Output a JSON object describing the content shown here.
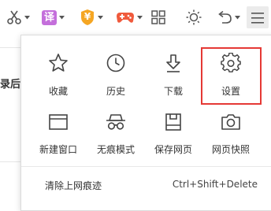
{
  "menu": {
    "row1": [
      {
        "label": "收藏"
      },
      {
        "label": "历史"
      },
      {
        "label": "下载"
      },
      {
        "label": "设置"
      }
    ],
    "row2": [
      {
        "label": "新建窗口"
      },
      {
        "label": "无痕模式"
      },
      {
        "label": "保存网页"
      },
      {
        "label": "网页快照"
      }
    ],
    "clear_history": {
      "label": "清除上网痕迹",
      "shortcut": "Ctrl+Shift+Delete"
    }
  },
  "toolbar": {
    "translate_glyph": "译",
    "yen_glyph": "¥"
  },
  "page": {
    "fragment": "录后"
  },
  "colors": {
    "accent_orange": "#f5a623",
    "highlight_red": "#e53935",
    "game_red": "#f05a3c"
  }
}
